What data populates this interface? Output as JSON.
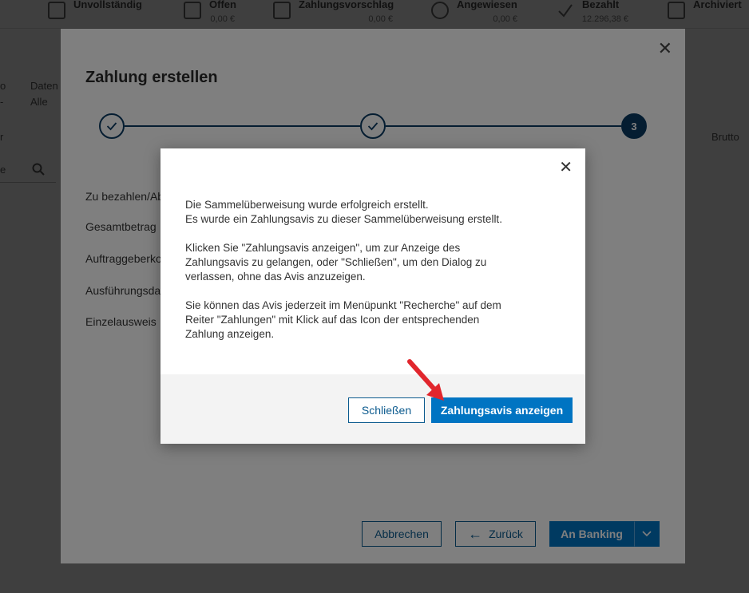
{
  "status_tabs": [
    {
      "label": "Unvollständig",
      "amount": "",
      "icon": "edit-icon"
    },
    {
      "label": "Offen",
      "amount": "0,00 €",
      "icon": "inbox-icon"
    },
    {
      "label": "Zahlungsvorschlag",
      "amount": "0,00 €",
      "icon": "printer-icon"
    },
    {
      "label": "Angewiesen",
      "amount": "0,00 €",
      "icon": "clock-icon"
    },
    {
      "label": "Bezahlt",
      "amount": "12.296,38 €",
      "icon": "check-icon"
    },
    {
      "label": "Archiviert",
      "amount": "",
      "icon": "archive-icon"
    }
  ],
  "background": {
    "filter_label_left": "o",
    "filter_label_date": "Daten",
    "filter_value_left": "-",
    "filter_value_date": "Alle",
    "column_left": "r",
    "column_brutto": "Brutto",
    "search_partial": "e"
  },
  "payment_dialog": {
    "title": "Zahlung erstellen",
    "steps": [
      {
        "state": "done",
        "label": ""
      },
      {
        "state": "done",
        "label": ""
      },
      {
        "state": "active",
        "label": "3"
      }
    ],
    "fields": [
      "Zu bezahlen/Ab",
      "Gesamtbetrag",
      "Auftraggeberko",
      "Ausführungsda",
      "Einzelausweis"
    ],
    "buttons": {
      "cancel": "Abbrechen",
      "back": "Zurück",
      "to_banking": "An Banking"
    }
  },
  "confirm_modal": {
    "paragraphs": [
      "Die Sammelüberweisung wurde erfolgreich erstellt.\nEs wurde ein Zahlungsavis zu dieser Sammelüberweisung erstellt.",
      "Klicken Sie \"Zahlungsavis anzeigen\", um zur Anzeige des\nZahlungsavis zu gelangen, oder \"Schließen\", um den Dialog zu\nverlassen, ohne das Avis anzuzeigen.",
      "Sie können das Avis jederzeit im Menüpunkt \"Recherche\" auf dem\nReiter \"Zahlungen\" mit Klick auf das Icon der entsprechenden\nZahlung anzeigen."
    ],
    "close_label": "Schließen",
    "primary_label": "Zahlungsavis anzeigen"
  },
  "colors": {
    "primary": "#0074c2",
    "stepper": "#0a3a63",
    "arrow": "#e1262d"
  }
}
